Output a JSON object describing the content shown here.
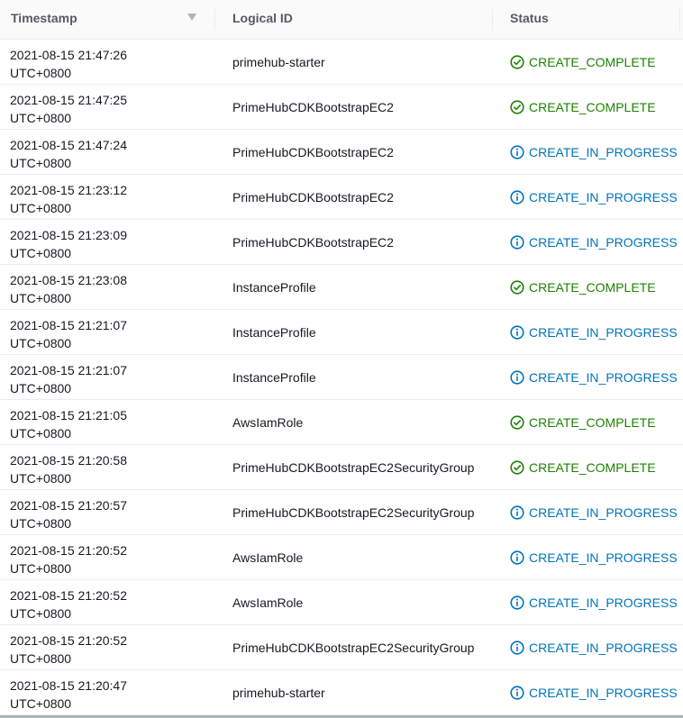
{
  "table": {
    "headers": {
      "timestamp": "Timestamp",
      "logical_id": "Logical ID",
      "status": "Status"
    },
    "sort_column": "timestamp",
    "sort_direction": "descending",
    "rows": [
      {
        "date": "2021-08-15 21:47:26",
        "tz": "UTC+0800",
        "logical_id": "primehub-starter",
        "status": "CREATE_COMPLETE",
        "kind": "success"
      },
      {
        "date": "2021-08-15 21:47:25",
        "tz": "UTC+0800",
        "logical_id": "PrimeHubCDKBootstrapEC2",
        "status": "CREATE_COMPLETE",
        "kind": "success"
      },
      {
        "date": "2021-08-15 21:47:24",
        "tz": "UTC+0800",
        "logical_id": "PrimeHubCDKBootstrapEC2",
        "status": "CREATE_IN_PROGRESS",
        "kind": "info"
      },
      {
        "date": "2021-08-15 21:23:12",
        "tz": "UTC+0800",
        "logical_id": "PrimeHubCDKBootstrapEC2",
        "status": "CREATE_IN_PROGRESS",
        "kind": "info"
      },
      {
        "date": "2021-08-15 21:23:09",
        "tz": "UTC+0800",
        "logical_id": "PrimeHubCDKBootstrapEC2",
        "status": "CREATE_IN_PROGRESS",
        "kind": "info"
      },
      {
        "date": "2021-08-15 21:23:08",
        "tz": "UTC+0800",
        "logical_id": "InstanceProfile",
        "status": "CREATE_COMPLETE",
        "kind": "success"
      },
      {
        "date": "2021-08-15 21:21:07",
        "tz": "UTC+0800",
        "logical_id": "InstanceProfile",
        "status": "CREATE_IN_PROGRESS",
        "kind": "info"
      },
      {
        "date": "2021-08-15 21:21:07",
        "tz": "UTC+0800",
        "logical_id": "InstanceProfile",
        "status": "CREATE_IN_PROGRESS",
        "kind": "info"
      },
      {
        "date": "2021-08-15 21:21:05",
        "tz": "UTC+0800",
        "logical_id": "AwsIamRole",
        "status": "CREATE_COMPLETE",
        "kind": "success"
      },
      {
        "date": "2021-08-15 21:20:58",
        "tz": "UTC+0800",
        "logical_id": "PrimeHubCDKBootstrapEC2SecurityGroup",
        "status": "CREATE_COMPLETE",
        "kind": "success"
      },
      {
        "date": "2021-08-15 21:20:57",
        "tz": "UTC+0800",
        "logical_id": "PrimeHubCDKBootstrapEC2SecurityGroup",
        "status": "CREATE_IN_PROGRESS",
        "kind": "info"
      },
      {
        "date": "2021-08-15 21:20:52",
        "tz": "UTC+0800",
        "logical_id": "AwsIamRole",
        "status": "CREATE_IN_PROGRESS",
        "kind": "info"
      },
      {
        "date": "2021-08-15 21:20:52",
        "tz": "UTC+0800",
        "logical_id": "AwsIamRole",
        "status": "CREATE_IN_PROGRESS",
        "kind": "info"
      },
      {
        "date": "2021-08-15 21:20:52",
        "tz": "UTC+0800",
        "logical_id": "PrimeHubCDKBootstrapEC2SecurityGroup",
        "status": "CREATE_IN_PROGRESS",
        "kind": "info"
      },
      {
        "date": "2021-08-15 21:20:47",
        "tz": "UTC+0800",
        "logical_id": "primehub-starter",
        "status": "CREATE_IN_PROGRESS",
        "kind": "info"
      }
    ]
  },
  "colors": {
    "success": "#1d8102",
    "info": "#0073bb",
    "header_text": "#545b64",
    "border": "#eaeded"
  },
  "icons": {
    "success": "status-success-icon",
    "info": "status-info-icon",
    "sort": "sort-descending-icon"
  }
}
